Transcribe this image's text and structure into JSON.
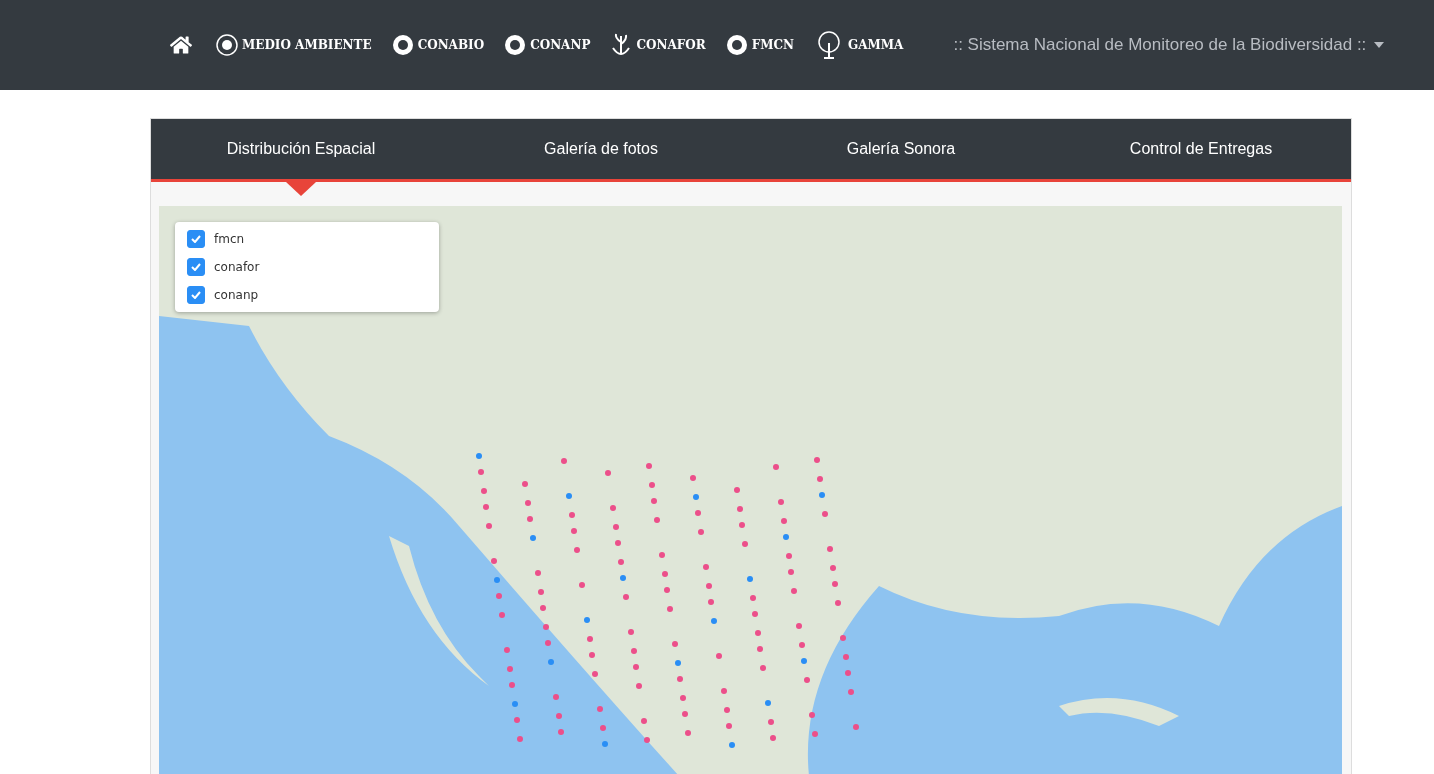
{
  "header": {
    "logos": [
      {
        "kind": "emblem",
        "name": "MEDIO AMBIENTE"
      },
      {
        "kind": "circle",
        "name": "CONABIO"
      },
      {
        "kind": "circle",
        "name": "CONANP"
      },
      {
        "kind": "plant",
        "name": "CONAFOR"
      },
      {
        "kind": "circle",
        "name": "FMCN"
      },
      {
        "kind": "tree",
        "name": "GAMMA"
      }
    ],
    "system_menu": {
      "label": ":: Sistema Nacional de Monitoreo de la Biodiversidad ::"
    }
  },
  "tabs": [
    {
      "label": "Distribución Espacial",
      "selected": true
    },
    {
      "label": "Galería de fotos",
      "selected": false
    },
    {
      "label": "Galería Sonora",
      "selected": false
    },
    {
      "label": "Control de Entregas",
      "selected": false
    }
  ],
  "layers": [
    {
      "label": "fmcn",
      "checked": true
    },
    {
      "label": "conafor",
      "checked": true
    },
    {
      "label": "conanp",
      "checked": true
    }
  ]
}
